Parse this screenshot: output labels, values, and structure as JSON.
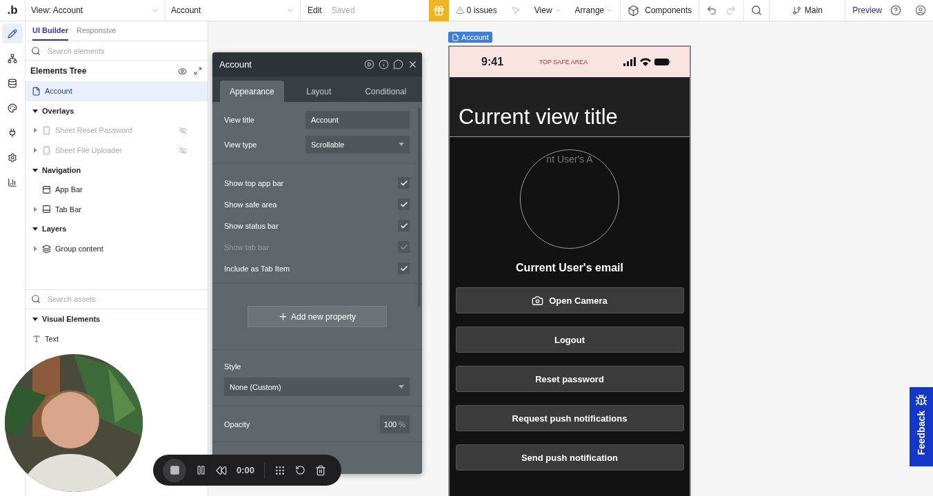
{
  "topbar": {
    "logo": ".b",
    "page_selector": "View: Account",
    "element_selector": "Account",
    "edit": "Edit",
    "status": "Saved",
    "issues": "0 issues",
    "view": "View",
    "arrange": "Arrange",
    "components": "Components",
    "branch": "Main",
    "preview": "Preview"
  },
  "rail": [
    {
      "kind": "pencil",
      "selected": true
    },
    {
      "kind": "network",
      "selected": false
    },
    {
      "kind": "database",
      "selected": false
    },
    {
      "kind": "palette",
      "selected": false
    },
    {
      "kind": "plug",
      "selected": false
    },
    {
      "kind": "gear",
      "selected": false
    },
    {
      "kind": "chart",
      "selected": false
    }
  ],
  "left_panel": {
    "tabs": [
      {
        "label": "UI Builder",
        "selected": true
      },
      {
        "label": "Responsive",
        "selected": false
      }
    ],
    "search": {
      "placeholder": "Search elements"
    },
    "tree_title": "Elements Tree",
    "root": {
      "label": "Account",
      "selected": true
    },
    "groups": [
      {
        "label": "Overlays",
        "expanded": true,
        "children": [
          {
            "label": "Sheet Reset Password",
            "kind": "sheet",
            "expandable": true,
            "hidden": true
          },
          {
            "label": "Sheet File Uploader",
            "kind": "sheet",
            "expandable": true,
            "hidden": true
          }
        ]
      },
      {
        "label": "Navigation",
        "expanded": true,
        "children": [
          {
            "label": "App Bar",
            "kind": "appbar",
            "expandable": false,
            "hidden": false
          },
          {
            "label": "Tab Bar",
            "kind": "tabbar",
            "expandable": true,
            "hidden": false
          }
        ]
      },
      {
        "label": "Layers",
        "expanded": true,
        "children": [
          {
            "label": "Group content",
            "kind": "group",
            "expandable": true,
            "hidden": false
          }
        ]
      }
    ],
    "assets_search": {
      "placeholder": "Search assets"
    },
    "asset_sections": [
      {
        "label": "Visual Elements",
        "expanded": true,
        "items": [
          {
            "label": "Text"
          }
        ]
      }
    ]
  },
  "property_panel": {
    "title": "Account",
    "tabs": [
      {
        "label": "Appearance",
        "selected": true
      },
      {
        "label": "Layout",
        "selected": false
      },
      {
        "label": "Conditional",
        "selected": false
      }
    ],
    "fields": [
      {
        "label": "View title",
        "kind": "text",
        "value": "Account"
      },
      {
        "label": "View type",
        "kind": "select",
        "value": "Scrollable"
      }
    ],
    "checks": [
      {
        "label": "Show top app bar",
        "checked": true,
        "disabled": false
      },
      {
        "label": "Show safe area",
        "checked": true,
        "disabled": false
      },
      {
        "label": "Show status bar",
        "checked": true,
        "disabled": false
      },
      {
        "label": "Show tab bar",
        "checked": true,
        "disabled": true
      },
      {
        "label": "Include as Tab Item",
        "checked": true,
        "disabled": false
      }
    ],
    "add_button": "Add new property",
    "style": {
      "label": "Style",
      "value": "None (Custom)"
    },
    "opacity": {
      "label": "Opacity",
      "value": "100",
      "unit": "%"
    }
  },
  "canvas": {
    "view_tag": "Account",
    "phone": {
      "time": "9:41",
      "safe_area": "TOP SAFE AREA",
      "title": "Current view title",
      "avatar_text": "nt User's A",
      "email": "Current User's email",
      "buttons": [
        {
          "label": "Open Camera",
          "kind": "camera"
        },
        {
          "label": "Logout",
          "kind": "plain"
        },
        {
          "label": "Reset password",
          "kind": "plain"
        },
        {
          "label": "Request push notifications",
          "kind": "plain"
        },
        {
          "label": "Send push notification",
          "kind": "plain"
        }
      ]
    }
  },
  "recorder": {
    "time": "0:00"
  },
  "feedback": "Feedback"
}
